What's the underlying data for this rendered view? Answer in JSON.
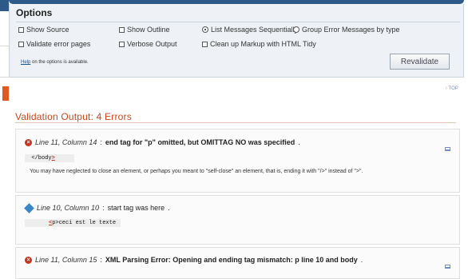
{
  "options": {
    "title": "Options",
    "checkboxes": {
      "show_source": "Show Source",
      "show_outline": "Show Outline",
      "validate_error_pages": "Validate error pages",
      "verbose_output": "Verbose Output",
      "clean_up_markup": "Clean up Markup with HTML Tidy"
    },
    "radios": {
      "list_sequentially": "List Messages Sequentially",
      "group_by_type": "Group Error Messages by type",
      "selected": "list_sequentially"
    },
    "help_link": "Help",
    "help_text": " on the options is available.",
    "revalidate_label": "Revalidate"
  },
  "top_link": "↑ TOP",
  "validation": {
    "title": "Validation Output: 4 Errors",
    "messages": [
      {
        "location": "Line 11, Column 14",
        "text": "end tag for \"p\" omitted, but OMITTAG NO was specified",
        "code_prefix": "  </body",
        "code_mark": ">",
        "code_suffix": "",
        "explanation": "You may have neglected to close an element, or perhaps you meant to \"self-close\" an element, that is, ending it with \"/>\" instead of \">\"."
      },
      {
        "location": "Line 10, Column 10",
        "text": "start tag was here",
        "code_prefix": "",
        "code_mark": "<",
        "code_suffix": "p>ceci est le texte"
      },
      {
        "location": "Line 11, Column 15",
        "text": "XML Parsing Error: Opening and ending tag mismatch: p line 10 and body"
      }
    ]
  },
  "colors": {
    "error": "#c8321e",
    "info": "#3a86c8",
    "heading": "#c8471a",
    "header_bar": "#2e5a8a"
  }
}
